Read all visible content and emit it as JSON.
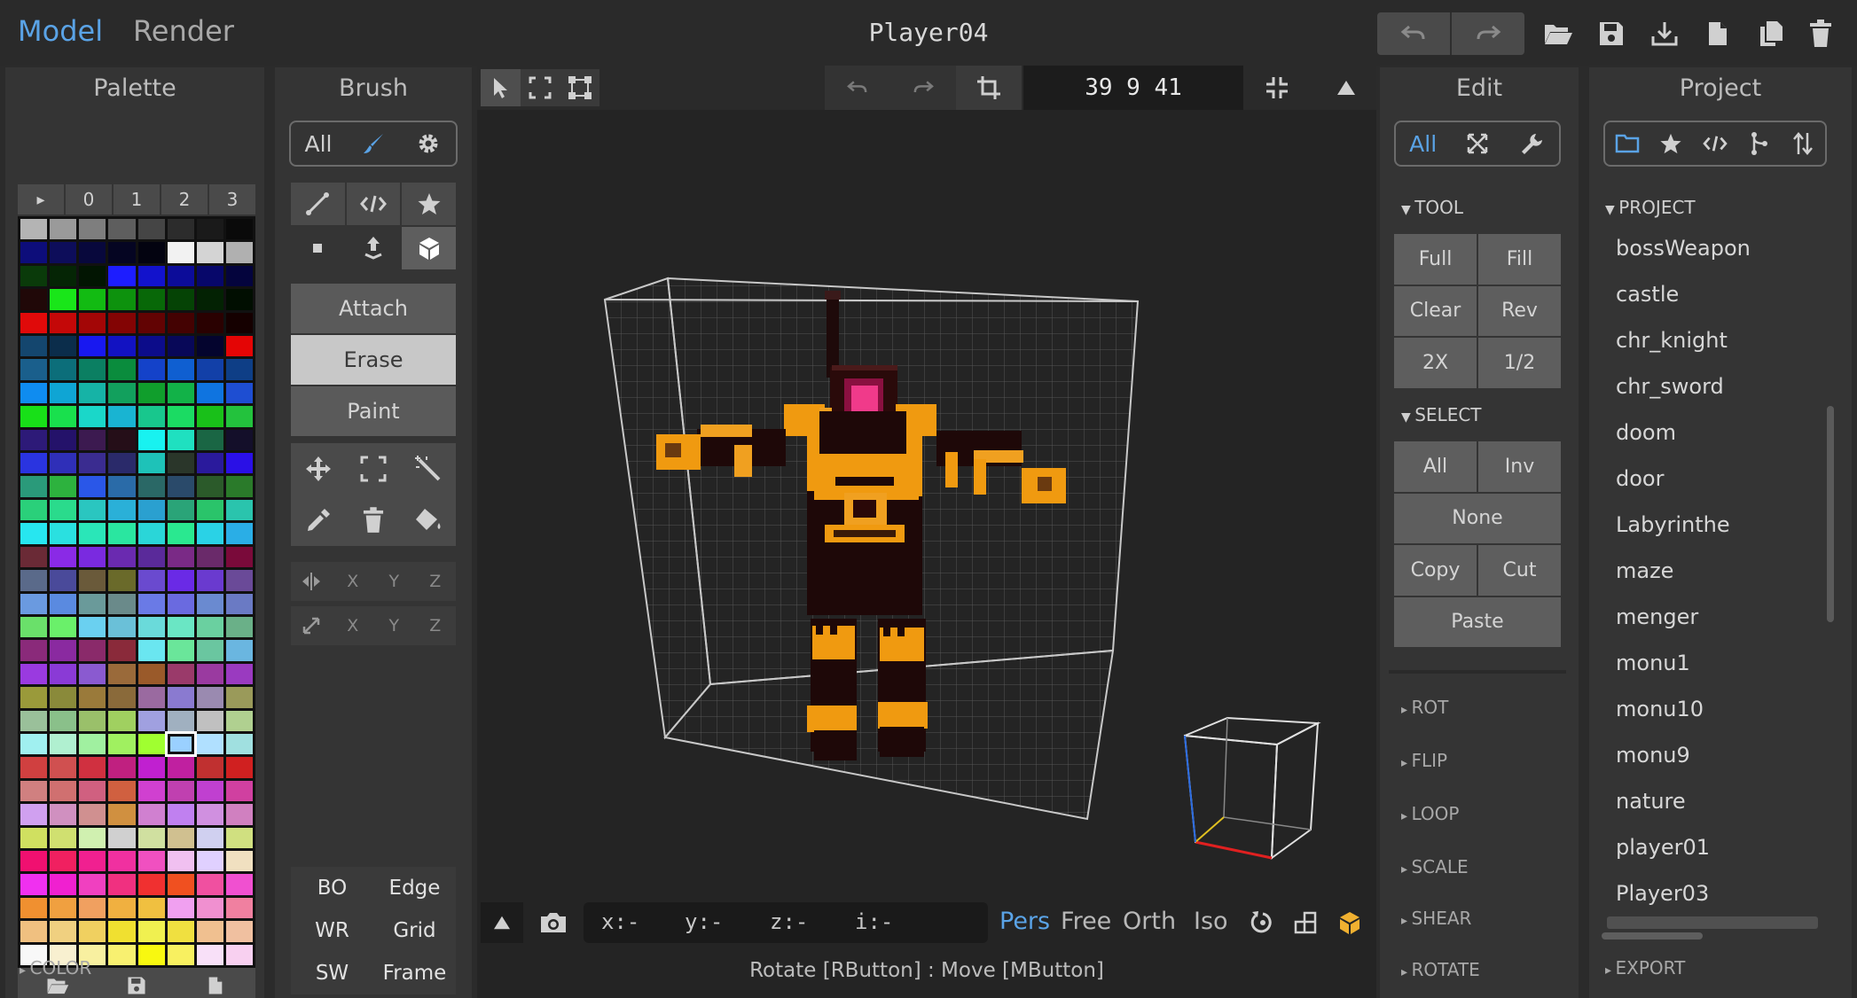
{
  "app": {
    "mode_tabs": [
      "Model",
      "Render"
    ],
    "active_mode": "Model",
    "document_title": "Player04"
  },
  "top_actions": [
    "undo-icon",
    "redo-icon",
    "folder-open-icon",
    "save-icon",
    "download-icon",
    "new-file-icon",
    "duplicate-icon",
    "trash-icon"
  ],
  "palette": {
    "title": "Palette",
    "tabs": [
      "▸",
      "0",
      "1",
      "2",
      "3"
    ],
    "footer_actions": [
      "folder-open-icon",
      "save-icon",
      "new-file-icon"
    ],
    "color_section": "COLOR",
    "colors": [
      [
        "#b4b4b4",
        "#9a9a9a",
        "#7e7e7e",
        "#5e5e5e",
        "#454545",
        "#2c2c2c",
        "#1a1a1a",
        "#0a0a0a"
      ],
      [
        "#0d0d7a",
        "#0d0d5a",
        "#08083c",
        "#050522",
        "#030310",
        "#f2f2f2",
        "#d4d4d4",
        "#b0b0b0"
      ],
      [
        "#0a3a0a",
        "#052505",
        "#021502",
        "#1d1dff",
        "#1212cc",
        "#0c0c99",
        "#07076a",
        "#04043d"
      ],
      [
        "#200808",
        "#19e619",
        "#12bb12",
        "#0d920d",
        "#086808",
        "#054305",
        "#032203",
        "#010e01"
      ],
      [
        "#e00a0a",
        "#c40808",
        "#a30606",
        "#830404",
        "#620303",
        "#440202",
        "#2a0101",
        "#150000"
      ],
      [
        "#14466e",
        "#0b2d4b",
        "#1818f0",
        "#1212c2",
        "#0c0c8a",
        "#080858",
        "#04042e",
        "#e40505"
      ],
      [
        "#1a5f8c",
        "#0c6e7a",
        "#0b7f62",
        "#0a8c3d",
        "#1442c9",
        "#0f5fd1",
        "#1240a8",
        "#0e3e86"
      ],
      [
        "#0f8cf0",
        "#0fa5d4",
        "#16b3a6",
        "#12a05d",
        "#109e2c",
        "#12b248",
        "#0f74e0",
        "#1e4ed2"
      ],
      [
        "#18e018",
        "#19e04d",
        "#1ad7c9",
        "#19b4d2",
        "#18c78d",
        "#1bdb63",
        "#19c019",
        "#23c23d"
      ],
      [
        "#2d1a78",
        "#24126a",
        "#3c1a50",
        "#250e18",
        "#18f2f0",
        "#1fe0c0",
        "#1a6644",
        "#140f2a"
      ],
      [
        "#2a34e0",
        "#2f2fb8",
        "#3a2c90",
        "#2a2a6a",
        "#1ec2b8",
        "#2a362a",
        "#2a1a9c",
        "#2a10e6"
      ],
      [
        "#2a9a7a",
        "#2db23e",
        "#2a57e8",
        "#2a6ba8",
        "#2a6866",
        "#2a4a6a",
        "#2b5a2a",
        "#2a7a2a"
      ],
      [
        "#2ad07a",
        "#2adb8c",
        "#2ac6c0",
        "#2ab0d8",
        "#2aa0d0",
        "#2aa478",
        "#2ac46a",
        "#2ac4ad"
      ],
      [
        "#27e6f0",
        "#2ae0e0",
        "#2ae6b8",
        "#2ae6a0",
        "#2ad6d8",
        "#2ae890",
        "#2ad2e6",
        "#2aaee6"
      ],
      [
        "#6a2a36",
        "#8a2ae6",
        "#7a2ae0",
        "#6a2ab0",
        "#5a2a9a",
        "#7a2a86",
        "#6a2a6a",
        "#7a0a3a"
      ],
      [
        "#5a6a8a",
        "#4a4a9a",
        "#6a5a3a",
        "#6a6a2a",
        "#6a4acf",
        "#6a2ae6",
        "#6a3acf",
        "#6a4a98"
      ],
      [
        "#6a9ae0",
        "#5a8ae0",
        "#6a9a9a",
        "#6a8a8a",
        "#6a7ae6",
        "#6a6ae0",
        "#6a8ad0",
        "#6a7ac4"
      ],
      [
        "#6ae06a",
        "#6af06a",
        "#6ad0f0",
        "#6ac0d8",
        "#6adada",
        "#6ae6c4",
        "#6ad0a0",
        "#6ab088"
      ],
      [
        "#8a2a7a",
        "#8a2aa0",
        "#8a2a6a",
        "#8a2a3a",
        "#6ae6f0",
        "#6ae69a",
        "#6ac6a0",
        "#6ab6e0"
      ],
      [
        "#9a3ae0",
        "#8a3ad6",
        "#8a5ad0",
        "#9a6a3a",
        "#9a5a2a",
        "#9a3a6a",
        "#9a3aa0",
        "#9a3ac0"
      ],
      [
        "#9a9a3a",
        "#8a8a3a",
        "#9a7a3a",
        "#8a6a3a",
        "#9a6aa0",
        "#8a7ad0",
        "#9a8ab0",
        "#9a9a5a"
      ],
      [
        "#9ac09a",
        "#8ac08a",
        "#9ac06a",
        "#a0d060",
        "#a0a0e0",
        "#a0b0c0",
        "#c0c0c0",
        "#b0d090"
      ],
      [
        "#a0f0f0",
        "#b0f0d0",
        "#a0f0a0",
        "#a0f060",
        "#a0ff30",
        "#9ad0ff",
        "#b0e0ff",
        "#a0e0e0"
      ],
      [
        "#d04040",
        "#d05050",
        "#d03040",
        "#c02080",
        "#c020d0",
        "#c020a0",
        "#c03030",
        "#d02020"
      ],
      [
        "#d08080",
        "#d07070",
        "#d06080",
        "#d06040",
        "#d040d0",
        "#c040b0",
        "#c040d0",
        "#d040a0"
      ],
      [
        "#d0a0f0",
        "#d090c0",
        "#d09090",
        "#d09040",
        "#d080d0",
        "#c080f0",
        "#d090e0",
        "#d080c0"
      ],
      [
        "#d0e060",
        "#d0e070",
        "#d0f0b0",
        "#d0d0d0",
        "#d0e0a0",
        "#d0c090",
        "#d0d0f0",
        "#d0e080"
      ],
      [
        "#f01070",
        "#f02060",
        "#f02090",
        "#f030a0",
        "#f050c0",
        "#f0c0f0",
        "#e0d0ff",
        "#f0e0c0"
      ],
      [
        "#f030f0",
        "#f020d0",
        "#f040c0",
        "#f03080",
        "#f03030",
        "#f05020",
        "#f050a0",
        "#f050d0"
      ],
      [
        "#f09030",
        "#f0a040",
        "#f0a060",
        "#f0b040",
        "#f0c040",
        "#f0a0f0",
        "#f090d0",
        "#f080a0"
      ],
      [
        "#f0c080",
        "#f0d080",
        "#f0d060",
        "#f0e030",
        "#f0f050",
        "#f0e040",
        "#f0c090",
        "#f0c0a0"
      ],
      [
        "#f8f8f8",
        "#f8f0d0",
        "#f8f0a0",
        "#f8f070",
        "#f8f810",
        "#f8f060",
        "#f8e0f8",
        "#f8d0f0"
      ]
    ],
    "selected": {
      "row": 22,
      "col": 5
    }
  },
  "brush": {
    "title": "Brush",
    "filter": {
      "label": "All",
      "icons": [
        "brush-icon",
        "gear-icon"
      ]
    },
    "shape_tools": [
      "line-icon",
      "code-icon",
      "star-icon",
      "dot-icon",
      "extrude-icon",
      "cube-icon"
    ],
    "modes": [
      "Attach",
      "Erase",
      "Paint"
    ],
    "active_mode": "Erase",
    "edit_tools": [
      "move-icon",
      "box-select-icon",
      "magic-wand-icon",
      "eyedropper-icon",
      "trash-icon",
      "fill-bucket-icon"
    ],
    "mirror_axes": [
      "X",
      "Y",
      "Z"
    ],
    "scale_axes": [
      "X",
      "Y",
      "Z"
    ],
    "bottom_toggles": [
      [
        "BO",
        "Edge"
      ],
      [
        "WR",
        "Grid"
      ],
      [
        "SW",
        "Frame"
      ]
    ]
  },
  "viewport": {
    "toolbar_icons": [
      "select-arrow-icon",
      "select-box-icon",
      "select-corners-icon"
    ],
    "dimensions": "39 9 41",
    "bottom": {
      "coords": {
        "x": "x:-",
        "y": "y:-",
        "z": "z:-",
        "i": "i:-"
      },
      "modes": [
        "Pers",
        "Free",
        "Orth",
        "Iso"
      ],
      "active_mode": "Pers"
    },
    "status": "Rotate [RButton] : Move [MButton]"
  },
  "edit": {
    "title": "Edit",
    "filter": {
      "label": "All"
    },
    "tool_section": "TOOL",
    "tool_buttons": [
      [
        "Full",
        "Fill"
      ],
      [
        "Clear",
        "Rev"
      ],
      [
        "2X",
        "1/2"
      ]
    ],
    "select_section": "SELECT",
    "select_buttons": [
      [
        "All",
        "Inv"
      ],
      [
        "None"
      ],
      [
        "Copy",
        "Cut"
      ],
      [
        "Paste"
      ]
    ],
    "collapsed_sections": [
      "ROT",
      "FLIP",
      "LOOP",
      "SCALE",
      "SHEAR",
      "ROTATE"
    ]
  },
  "project": {
    "title": "Project",
    "section": "PROJECT",
    "items": [
      "bossWeapon",
      "castle",
      "chr_knight",
      "chr_sword",
      "doom",
      "door",
      "Labyrinthe",
      "maze",
      "menger",
      "monu1",
      "monu10",
      "monu9",
      "nature",
      "player01",
      "Player03"
    ],
    "export_section": "EXPORT"
  }
}
